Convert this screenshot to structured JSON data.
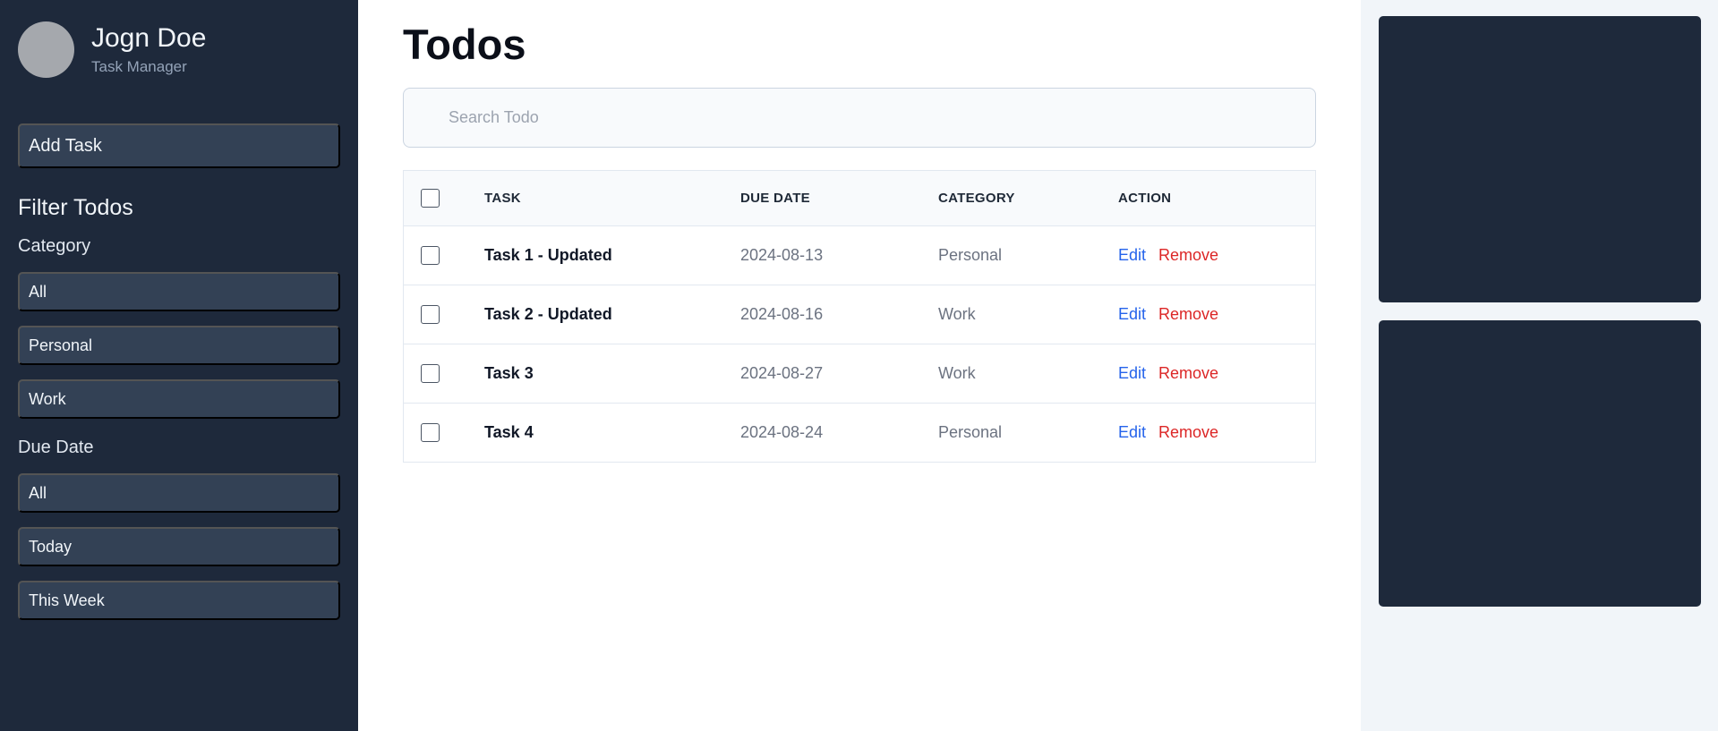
{
  "profile": {
    "name": "Jogn Doe",
    "role": "Task Manager"
  },
  "sidebar": {
    "add_task": "Add Task",
    "filter_heading": "Filter Todos",
    "category": {
      "label": "Category",
      "options": [
        "All",
        "Personal",
        "Work"
      ]
    },
    "due_date": {
      "label": "Due Date",
      "options": [
        "All",
        "Today",
        "This Week"
      ]
    }
  },
  "main": {
    "title": "Todos",
    "search": {
      "placeholder": "Search Todo",
      "value": ""
    },
    "table": {
      "headers": {
        "task": "TASK",
        "due_date": "DUE DATE",
        "category": "CATEGORY",
        "action": "ACTION"
      },
      "rows": [
        {
          "task": "Task 1 - Updated",
          "due_date": "2024-08-13",
          "category": "Personal",
          "edit": "Edit",
          "remove": "Remove"
        },
        {
          "task": "Task 2 - Updated",
          "due_date": "2024-08-16",
          "category": "Work",
          "edit": "Edit",
          "remove": "Remove"
        },
        {
          "task": "Task 3",
          "due_date": "2024-08-27",
          "category": "Work",
          "edit": "Edit",
          "remove": "Remove"
        },
        {
          "task": "Task 4",
          "due_date": "2024-08-24",
          "category": "Personal",
          "edit": "Edit",
          "remove": "Remove"
        }
      ]
    }
  },
  "colors": {
    "sidebar_bg": "#1e293b",
    "button_bg": "#334155",
    "edit": "#2563eb",
    "remove": "#dc2626",
    "right_panel_bg": "#f1f5f9"
  }
}
